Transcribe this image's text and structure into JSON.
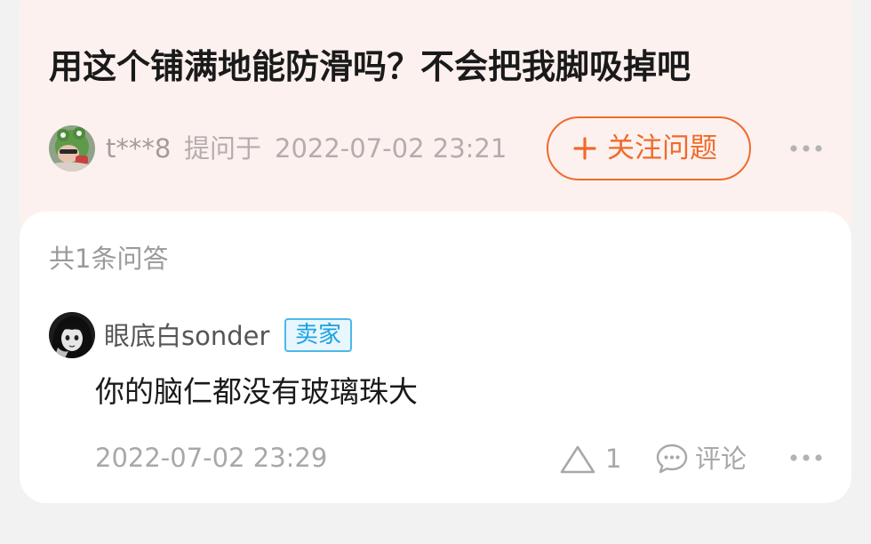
{
  "question": {
    "title": "用这个铺满地能防滑吗？不会把我脚吸掉吧",
    "asker_name": "t***8",
    "asked_label": "提问于",
    "asked_time": "2022-07-02 23:21",
    "follow_label": "关注问题"
  },
  "answers": {
    "count_label": "共1条问答",
    "items": [
      {
        "user_name": "眼底白sonder",
        "badge": "卖家",
        "text": "你的脑仁都没有玻璃珠大",
        "time": "2022-07-02 23:29",
        "like_count": "1",
        "comment_label": "评论"
      }
    ]
  },
  "icons": {
    "follow": "plus-icon",
    "more": "more-dots-icon",
    "like": "triangle-up-icon",
    "comment": "speech-bubble-icon"
  },
  "colors": {
    "accent": "#f06a2a",
    "seller_badge": "#1aa3e0",
    "question_background": "#fdf1ef",
    "page_background": "#f2f2f2"
  }
}
